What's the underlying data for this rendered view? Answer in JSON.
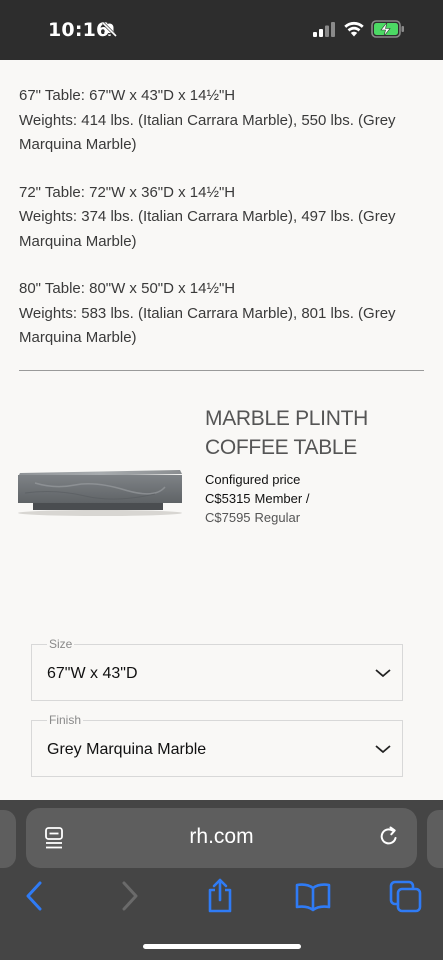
{
  "status_bar": {
    "time": "10:16"
  },
  "specs": [
    {
      "dimension": "67\" Table: 67\"W x 43\"D x 14½\"H",
      "weights": "Weights: 414 lbs. (Italian Carrara Marble), 550 lbs. (Grey Marquina Marble)"
    },
    {
      "dimension": "72\" Table: 72\"W x 36\"D x 14½\"H",
      "weights": "Weights: 374 lbs. (Italian Carrara Marble), 497 lbs. (Grey Marquina Marble)"
    },
    {
      "dimension": "80\" Table: 80\"W x 50\"D x 14½\"H",
      "weights": "Weights: 583 lbs. (Italian Carrara Marble), 801 lbs. (Grey Marquina Marble)"
    }
  ],
  "product": {
    "title_line1": "MARBLE PLINTH",
    "title_line2": "COFFEE TABLE",
    "price_label": "Configured price",
    "member_price": "C$5315",
    "member_label": "Member /",
    "regular_price": "C$7595",
    "regular_label": "Regular"
  },
  "options": {
    "size": {
      "label": "Size",
      "value": "67\"W x 43\"D"
    },
    "finish": {
      "label": "Finish",
      "value": "Grey Marquina Marble"
    }
  },
  "browser": {
    "url": "rh.com",
    "accent_color": "#2f7bf5"
  }
}
